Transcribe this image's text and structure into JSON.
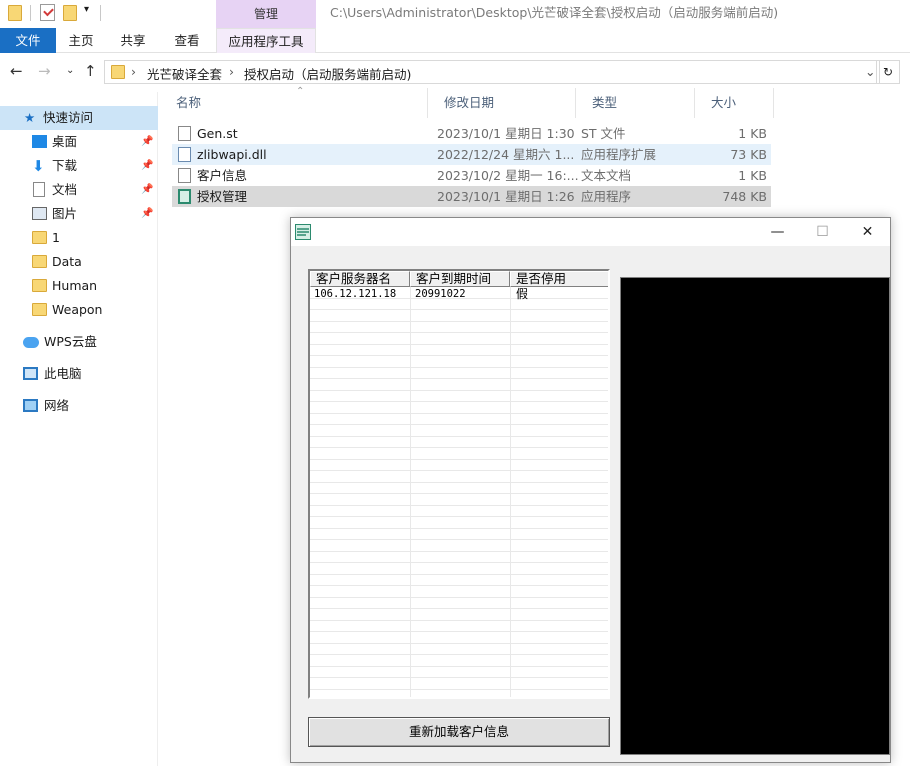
{
  "explorer": {
    "title_path": "C:\\Users\\Administrator\\Desktop\\光芒破译全套\\授权启动（启动服务端前启动)",
    "context_tab": "管理",
    "ribbon_tabs": {
      "file": "文件",
      "home": "主页",
      "share": "共享",
      "view": "查看",
      "app_tools": "应用程序工具"
    },
    "breadcrumb": {
      "part1": "光芒破译全套",
      "part2": "授权启动（启动服务端前启动)"
    },
    "columns": {
      "name": "名称",
      "modified": "修改日期",
      "type": "类型",
      "size": "大小"
    },
    "files": [
      {
        "name": "Gen.st",
        "modified": "2023/10/1 星期日 1:30",
        "type": "ST 文件",
        "size": "1 KB"
      },
      {
        "name": "zlibwapi.dll",
        "modified": "2022/12/24 星期六 1...",
        "type": "应用程序扩展",
        "size": "73 KB"
      },
      {
        "name": "客户信息",
        "modified": "2023/10/2 星期一 16:...",
        "type": "文本文档",
        "size": "1 KB"
      },
      {
        "name": "授权管理",
        "modified": "2023/10/1 星期日 1:26",
        "type": "应用程序",
        "size": "748 KB"
      }
    ],
    "nav": {
      "quick_access": "快速访问",
      "desktop": "桌面",
      "downloads": "下载",
      "documents": "文档",
      "pictures": "图片",
      "folder_1": "1",
      "folder_data": "Data",
      "folder_human": "Human",
      "folder_weapon": "Weapon",
      "wps_cloud": "WPS云盘",
      "this_pc": "此电脑",
      "network": "网络"
    }
  },
  "app": {
    "columns": {
      "server": "客户服务器名",
      "expiry": "客户到期时间",
      "disabled": "是否停用"
    },
    "rows": [
      {
        "server": "106.12.121.18",
        "expiry": "20991022",
        "disabled": "假"
      }
    ],
    "reload_button": "重新加载客户信息",
    "window_buttons": {
      "minimize": "—",
      "maximize": "☐",
      "close": "✕"
    }
  },
  "colors": {
    "accent": "#1a6fc4",
    "context_tab": "#e7d3f4",
    "selection": "#cce4f7",
    "console": "#000000"
  }
}
